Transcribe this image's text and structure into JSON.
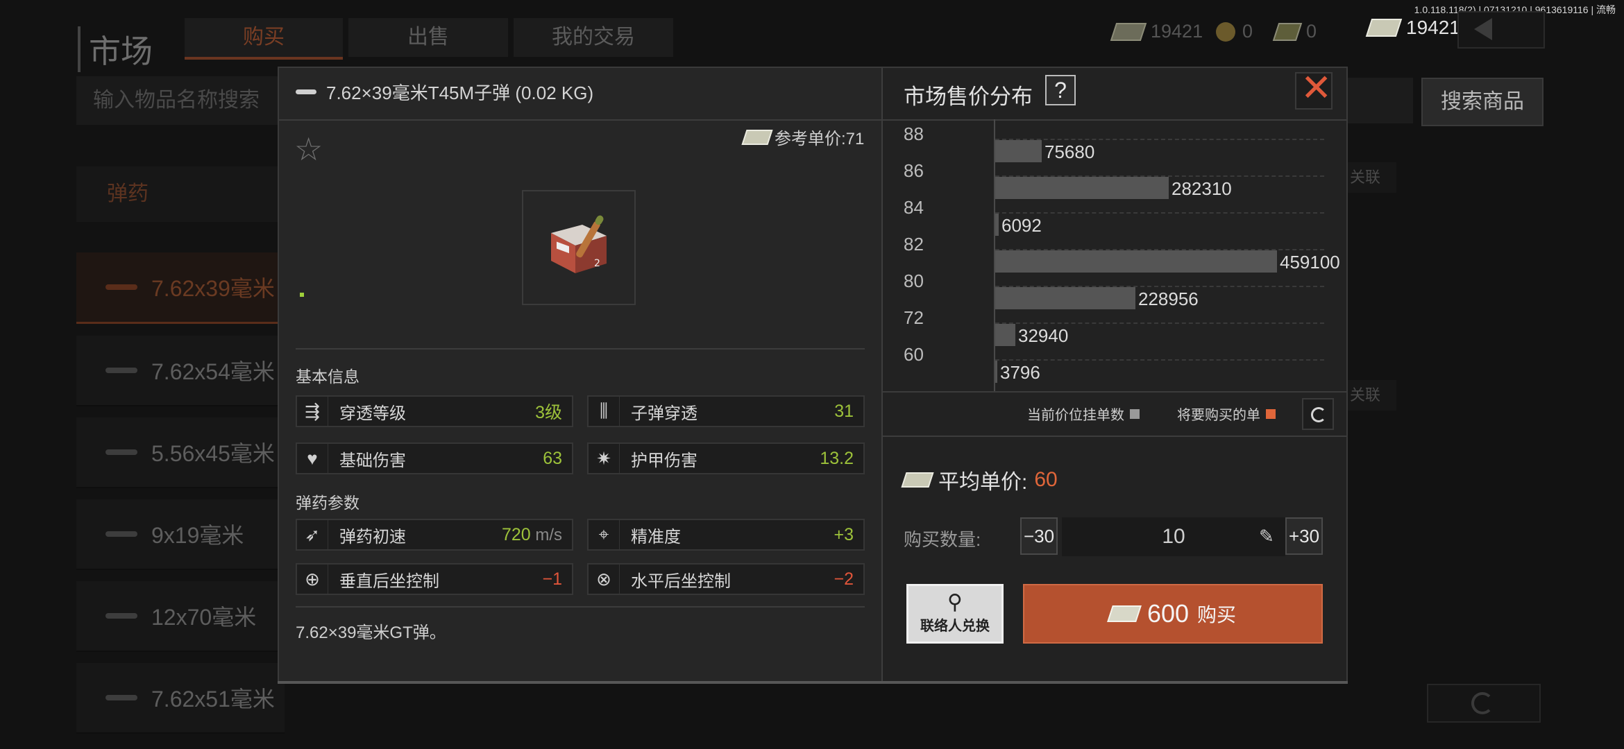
{
  "version": "1.0.118.118(2) | 07131210 | 9613619116 | 流畅",
  "background": {
    "title": "市场",
    "tabs": [
      "购买",
      "出售",
      "我的交易"
    ],
    "currencies": [
      {
        "icon": "cash-icon",
        "value": "19421"
      },
      {
        "icon": "coin-icon",
        "value": "0"
      },
      {
        "icon": "voucher-icon",
        "value": "0"
      }
    ],
    "search_placeholder": "输入物品名称搜索",
    "search_button": "搜索商品",
    "category": "弹药",
    "ammo_list": [
      "7.62x39毫米",
      "7.62x54毫米",
      "5.56x45毫米",
      "9x19毫米",
      "12x70毫米",
      "7.62x51毫米"
    ],
    "right_side_labels": [
      "关联",
      "关联"
    ]
  },
  "top_money": "19421",
  "modal": {
    "item_title": "7.62×39毫米T45M子弹 (0.02 KG)",
    "reference_price": "参考单价:71",
    "basic_info_label": "基本信息",
    "stats": [
      {
        "icon": "penetration-level-icon",
        "label": "穿透等级",
        "value": "3级",
        "tone": "green"
      },
      {
        "icon": "bullet-penetration-icon",
        "label": "子弹穿透",
        "value": "31",
        "tone": "green"
      },
      {
        "icon": "base-damage-icon",
        "label": "基础伤害",
        "value": "63",
        "tone": "green"
      },
      {
        "icon": "armor-damage-icon",
        "label": "护甲伤害",
        "value": "13.2",
        "tone": "green"
      }
    ],
    "ammo_params_label": "弹药参数",
    "params": [
      {
        "icon": "muzzle-velocity-icon",
        "label": "弹药初速",
        "value": "720",
        "unit": " m/s",
        "tone": "green"
      },
      {
        "icon": "accuracy-icon",
        "label": "精准度",
        "value": "+3",
        "tone": "green"
      },
      {
        "icon": "vertical-recoil-icon",
        "label": "垂直后坐控制",
        "value": "−1",
        "tone": "red"
      },
      {
        "icon": "horizontal-recoil-icon",
        "label": "水平后坐控制",
        "value": "−2",
        "tone": "red"
      }
    ],
    "description": "7.62×39毫米GT弹。"
  },
  "distribution": {
    "title": "市场售价分布",
    "help": "?",
    "legend_current": "当前价位挂单数",
    "legend_buy": "将要购买的单",
    "avg_label": "平均单价:",
    "avg_value": "60",
    "qty_label": "购买数量:",
    "minus": "−30",
    "qty": "10",
    "plus": "+30",
    "contact_label": "联络人兑换",
    "buy_amount": "600",
    "buy_label": "购买"
  },
  "chart_data": {
    "type": "bar",
    "orientation": "horizontal",
    "y_ticks": [
      "88",
      "86",
      "84",
      "82",
      "80",
      "72",
      "60"
    ],
    "values": [
      75680,
      282310,
      6092,
      459100,
      228956,
      32940,
      3796
    ],
    "colors": {
      "current": "#555555",
      "buy": "#e0663a"
    },
    "legend_placement": "bottom-right",
    "grid": true
  }
}
